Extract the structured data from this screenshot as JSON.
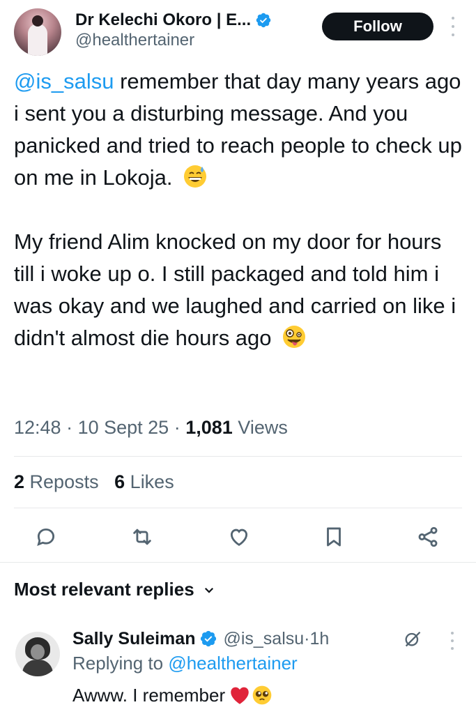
{
  "author": {
    "name": "Dr Kelechi Okoro | E...",
    "handle": "@healthertainer",
    "verified": true
  },
  "follow_button": {
    "label": "Follow"
  },
  "tweet": {
    "mention": "@is_salsu",
    "paragraph1_rest": " remember that day many years ago i sent you a disturbing message.  And you panicked and tried to reach people to check up on me in Lokoja. ",
    "paragraph1_emoji": "grinning-sweat-emoji",
    "paragraph2": "My friend Alim knocked on my door for hours till i woke up o.  I still packaged and told him i was okay and we laughed and carried on like i didn't almost die hours ago ",
    "paragraph2_emoji": "zany-face-emoji"
  },
  "meta": {
    "time": "12:48",
    "date": "10 Sept 25",
    "views_count": "1,081",
    "views_label": "Views",
    "separator": " · "
  },
  "stats": {
    "reposts_count": "2",
    "reposts_label": "Reposts",
    "likes_count": "6",
    "likes_label": "Likes"
  },
  "actions": [
    "reply-icon",
    "repost-icon",
    "like-icon",
    "bookmark-icon",
    "share-icon"
  ],
  "replies_section": {
    "title": "Most relevant replies"
  },
  "reply": {
    "name": "Sally Suleiman",
    "handle": "@is_salsu",
    "time": "1h",
    "separator": " · ",
    "replying_prefix": "Replying to ",
    "replying_to": "@healthertainer",
    "text": "Awww. I remember",
    "emojis": [
      "red-heart-emoji",
      "pleading-face-emoji"
    ]
  },
  "colors": {
    "accent": "#1d9bf0",
    "text": "#0f1419",
    "secondary": "#536471",
    "divider": "#e7e9ea",
    "button_bg": "#0f1419"
  }
}
